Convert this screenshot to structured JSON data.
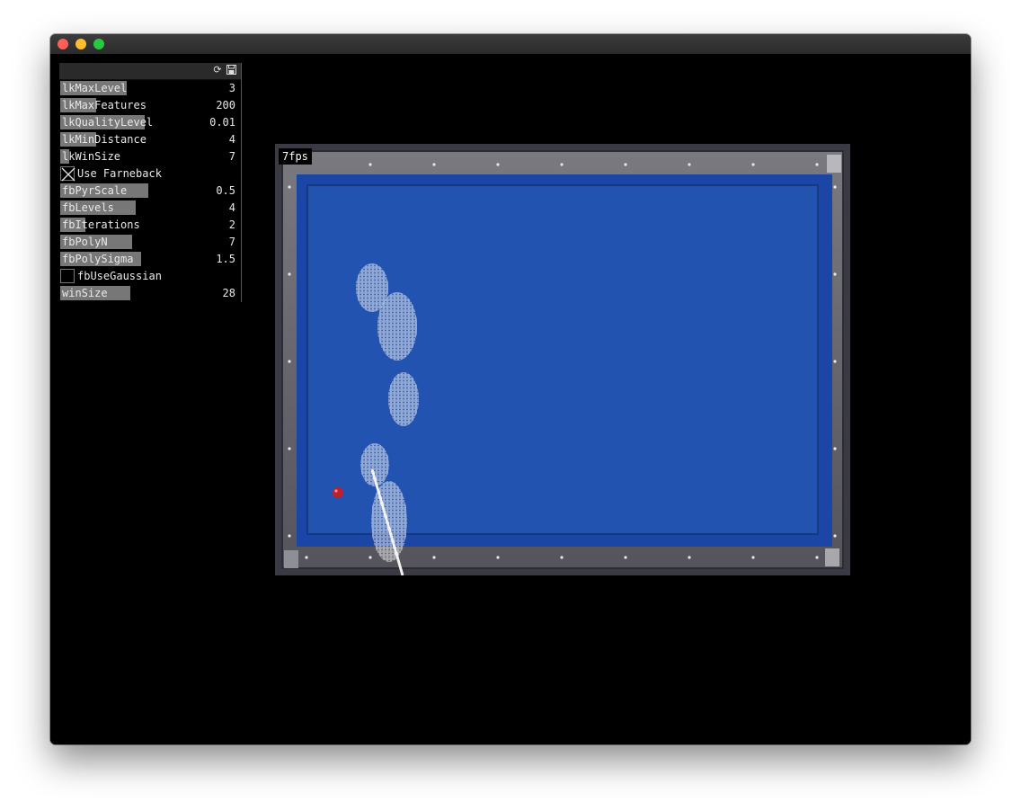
{
  "window": {
    "traffic_lights": {
      "close": "#fe5f57",
      "minimize": "#febc2e",
      "maximize": "#28c840"
    }
  },
  "panel": {
    "header_icons": [
      "reload-icon",
      "save-icon"
    ],
    "sliders": [
      {
        "label": "lkMaxLevel",
        "value": "3",
        "fill_fraction": 0.37
      },
      {
        "label": "lkMaxFeatures",
        "value": "200",
        "fill_fraction": 0.2
      },
      {
        "label": "lkQualityLevel",
        "value": "0.01",
        "fill_fraction": 0.47
      },
      {
        "label": "lkMinDistance",
        "value": "4",
        "fill_fraction": 0.2
      },
      {
        "label": "lkWinSize",
        "value": "7",
        "fill_fraction": 0.05
      }
    ],
    "farneback_toggle": {
      "label": "Use Farneback",
      "checked": true
    },
    "fb_sliders": [
      {
        "label": "fbPyrScale",
        "value": "0.5",
        "fill_fraction": 0.49
      },
      {
        "label": "fbLevels",
        "value": "4",
        "fill_fraction": 0.42
      },
      {
        "label": "fbIterations",
        "value": "2",
        "fill_fraction": 0.14
      },
      {
        "label": "fbPolyN",
        "value": "7",
        "fill_fraction": 0.4
      },
      {
        "label": "fbPolySigma",
        "value": "1.5",
        "fill_fraction": 0.45
      }
    ],
    "gaussian_toggle": {
      "label": "fbUseGaussian",
      "checked": false
    },
    "winsize_slider": {
      "label": "winSize",
      "value": "28",
      "fill_fraction": 0.39
    }
  },
  "video": {
    "fps_label": "7fps",
    "colors": {
      "cloth": "#2253b0",
      "rail": "#6b6a72",
      "ball_red": "#c0202a"
    }
  }
}
